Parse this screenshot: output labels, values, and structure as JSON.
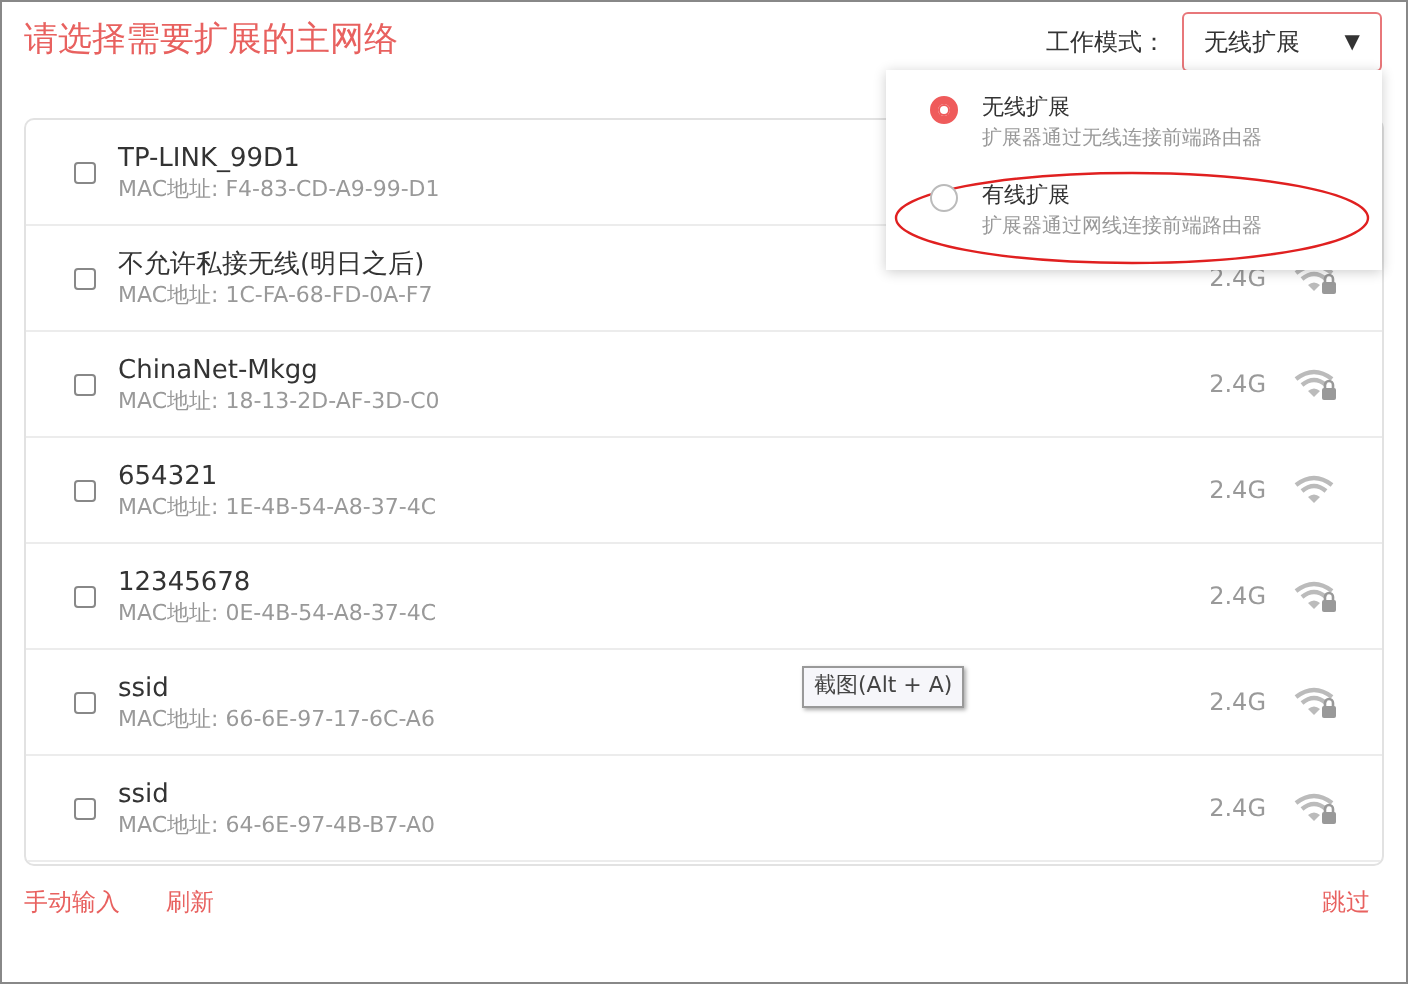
{
  "title": "请选择需要扩展的主网络",
  "mode": {
    "label": "工作模式：",
    "value": "无线扩展",
    "caret": "▼",
    "options": [
      {
        "name": "无线扩展",
        "description": "扩展器通过无线连接前端路由器",
        "selected": true
      },
      {
        "name": "有线扩展",
        "description": "扩展器通过网线连接前端路由器",
        "selected": false,
        "circled": true
      }
    ]
  },
  "networks": [
    {
      "ssid": "TP-LINK_99D1",
      "mac": "MAC地址: F4-83-CD-A9-99-D1",
      "checked": false
    },
    {
      "ssid": "不允许私接无线(明日之后)",
      "mac": "MAC地址: 1C-FA-68-FD-0A-F7",
      "checked": false,
      "band": "2.4G",
      "locked": true
    },
    {
      "ssid": "ChinaNet-Mkgg",
      "mac": "MAC地址: 18-13-2D-AF-3D-C0",
      "checked": false,
      "band": "2.4G",
      "locked": true
    },
    {
      "ssid": "654321",
      "mac": "MAC地址: 1E-4B-54-A8-37-4C",
      "checked": false,
      "band": "2.4G",
      "locked": false
    },
    {
      "ssid": "12345678",
      "mac": "MAC地址: 0E-4B-54-A8-37-4C",
      "checked": false,
      "band": "2.4G",
      "locked": true
    },
    {
      "ssid": "ssid",
      "mac": "MAC地址: 66-6E-97-17-6C-A6",
      "checked": false,
      "band": "2.4G",
      "locked": true
    },
    {
      "ssid": "ssid",
      "mac": "MAC地址: 64-6E-97-4B-B7-A0",
      "checked": false,
      "band": "2.4G",
      "locked": true
    }
  ],
  "tooltip": "截图(Alt + A)",
  "footer_left": [
    "手动输入",
    "刷新"
  ],
  "footer_right": "跳过"
}
